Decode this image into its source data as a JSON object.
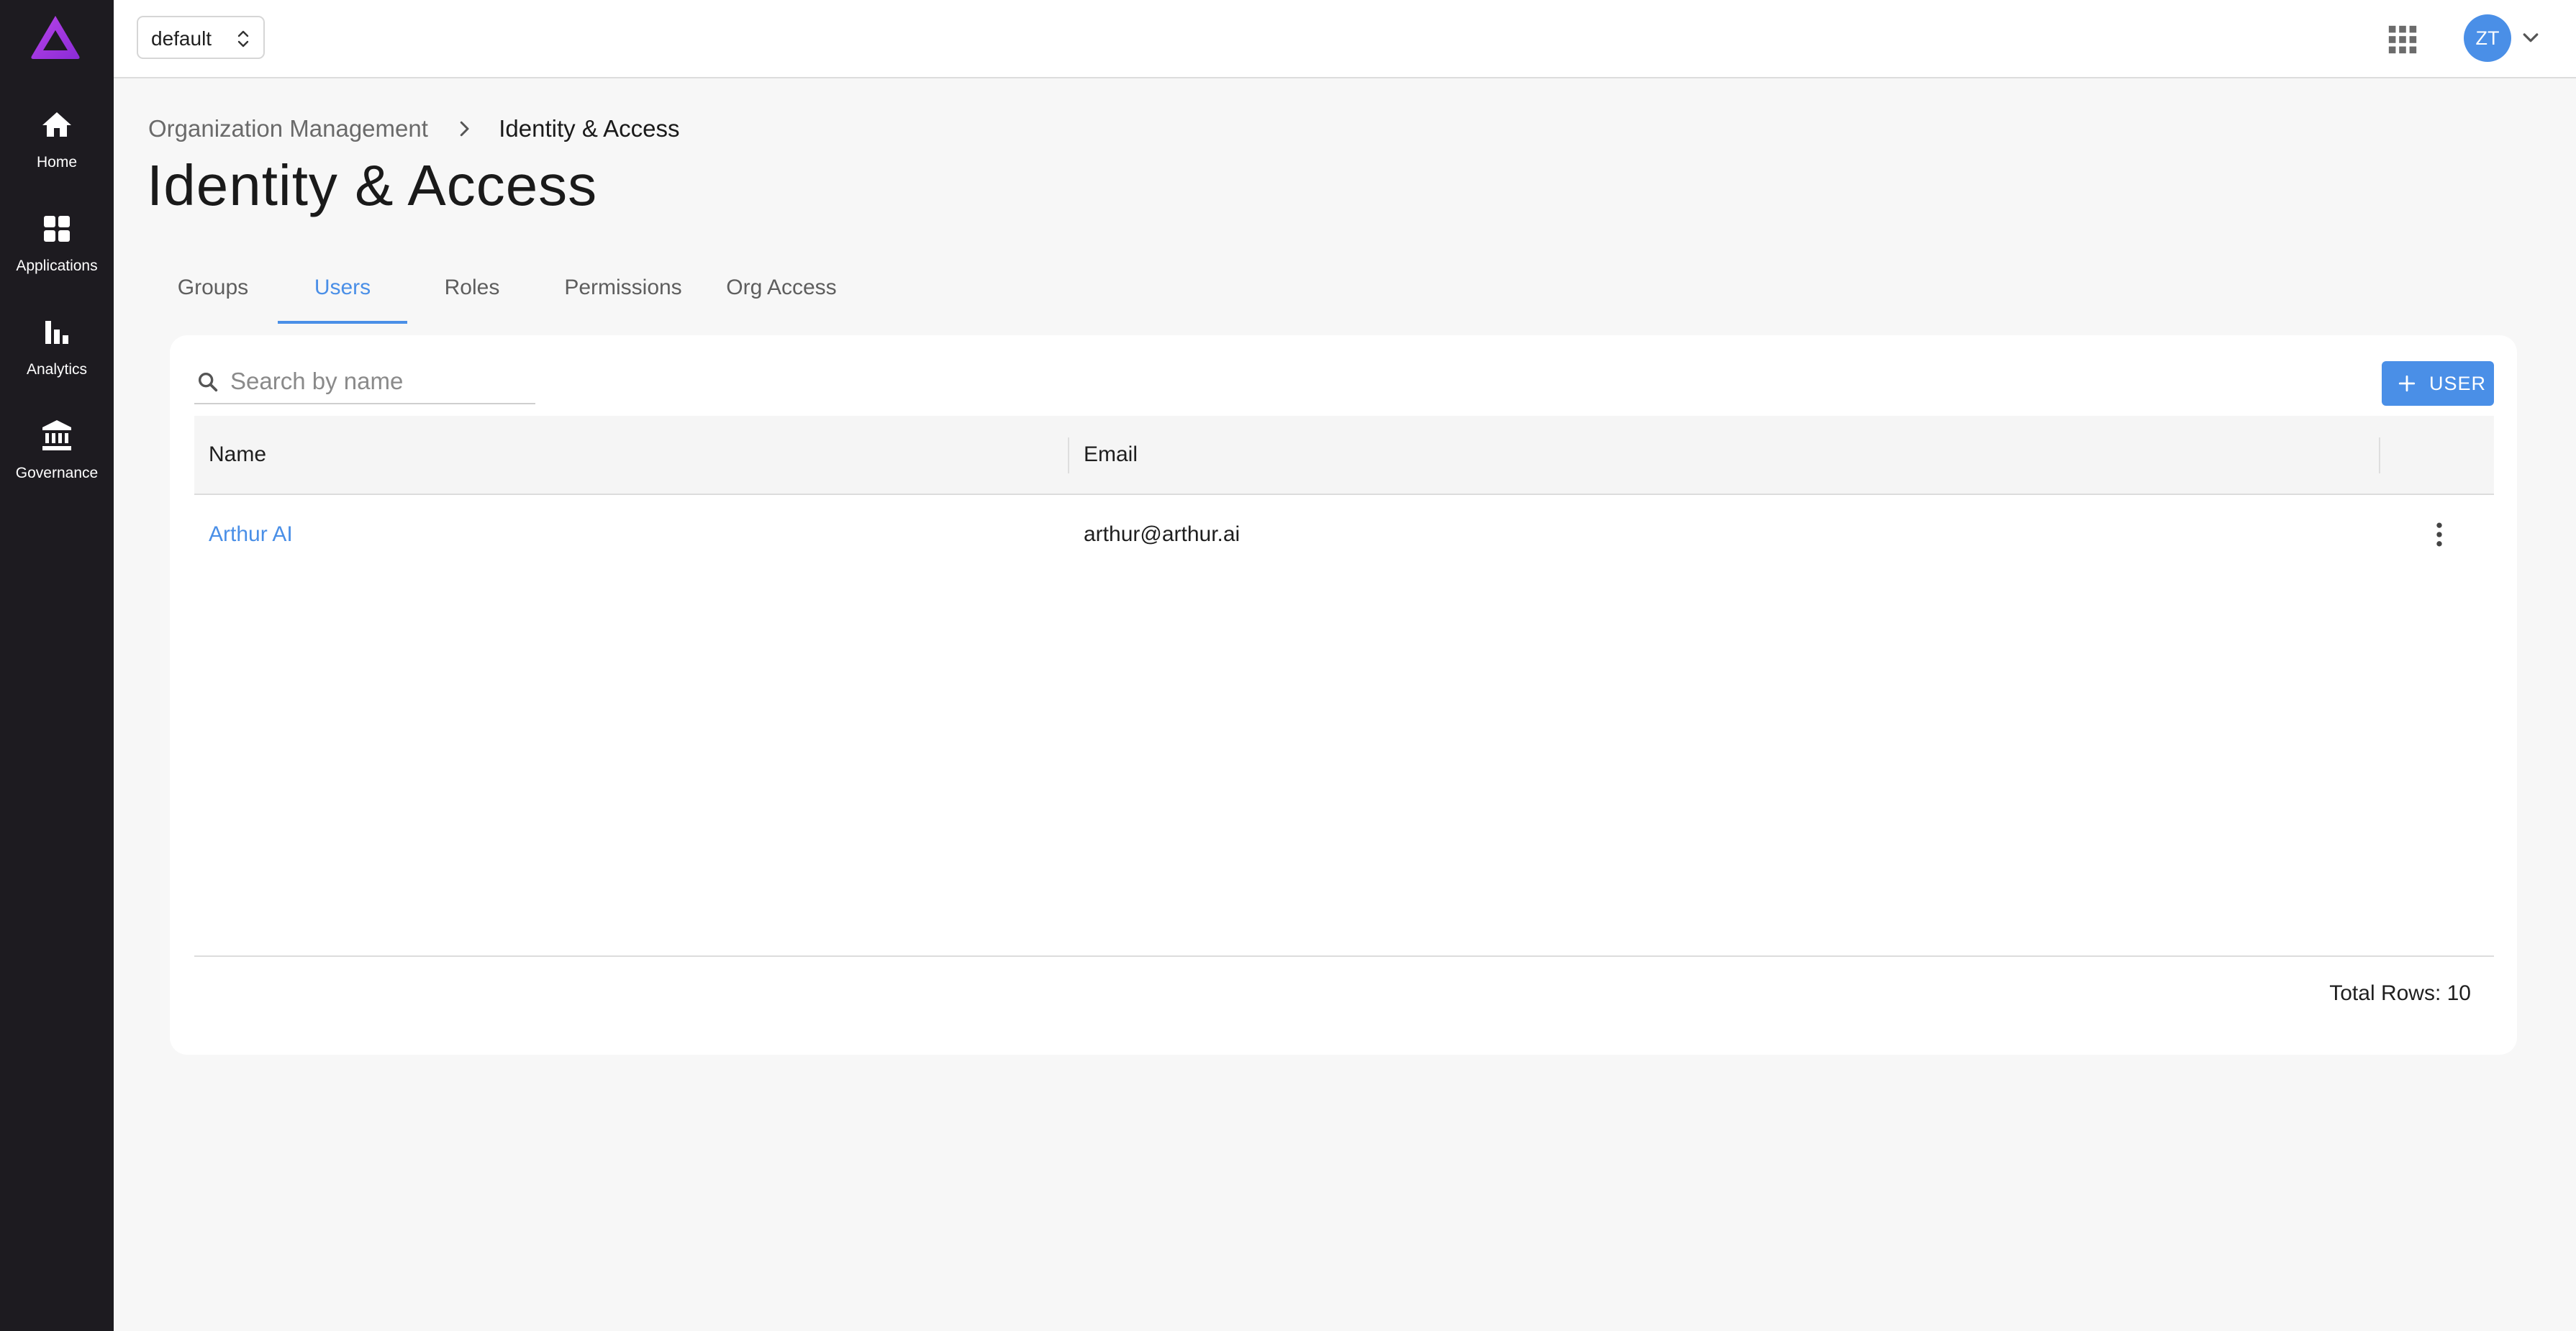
{
  "app": {
    "logo": "arthur-logo"
  },
  "sidebar": {
    "items": [
      {
        "label": "Home",
        "icon": "home-icon"
      },
      {
        "label": "Applications",
        "icon": "grid-icon"
      },
      {
        "label": "Analytics",
        "icon": "bar-chart-icon"
      },
      {
        "label": "Governance",
        "icon": "bank-icon"
      }
    ]
  },
  "topbar": {
    "workspace": "default",
    "avatar_initials": "ZT"
  },
  "breadcrumb": {
    "parent": "Organization Management",
    "current": "Identity & Access"
  },
  "page": {
    "title": "Identity & Access"
  },
  "tabs": [
    {
      "label": "Groups",
      "active": false
    },
    {
      "label": "Users",
      "active": true
    },
    {
      "label": "Roles",
      "active": false
    },
    {
      "label": "Permissions",
      "active": false
    },
    {
      "label": "Org Access",
      "active": false
    }
  ],
  "search": {
    "placeholder": "Search by name",
    "value": ""
  },
  "add_button": {
    "label": "USER"
  },
  "table": {
    "columns": [
      "Name",
      "Email"
    ],
    "rows": [
      {
        "name": "Arthur AI",
        "email": "arthur@arthur.ai"
      }
    ],
    "total_rows": "Total Rows: 10"
  },
  "colors": {
    "sidebar_bg": "#1d1b20",
    "accent": "#4a8fe7",
    "logo": "#a335e0",
    "page_bg": "#f7f7f7"
  }
}
